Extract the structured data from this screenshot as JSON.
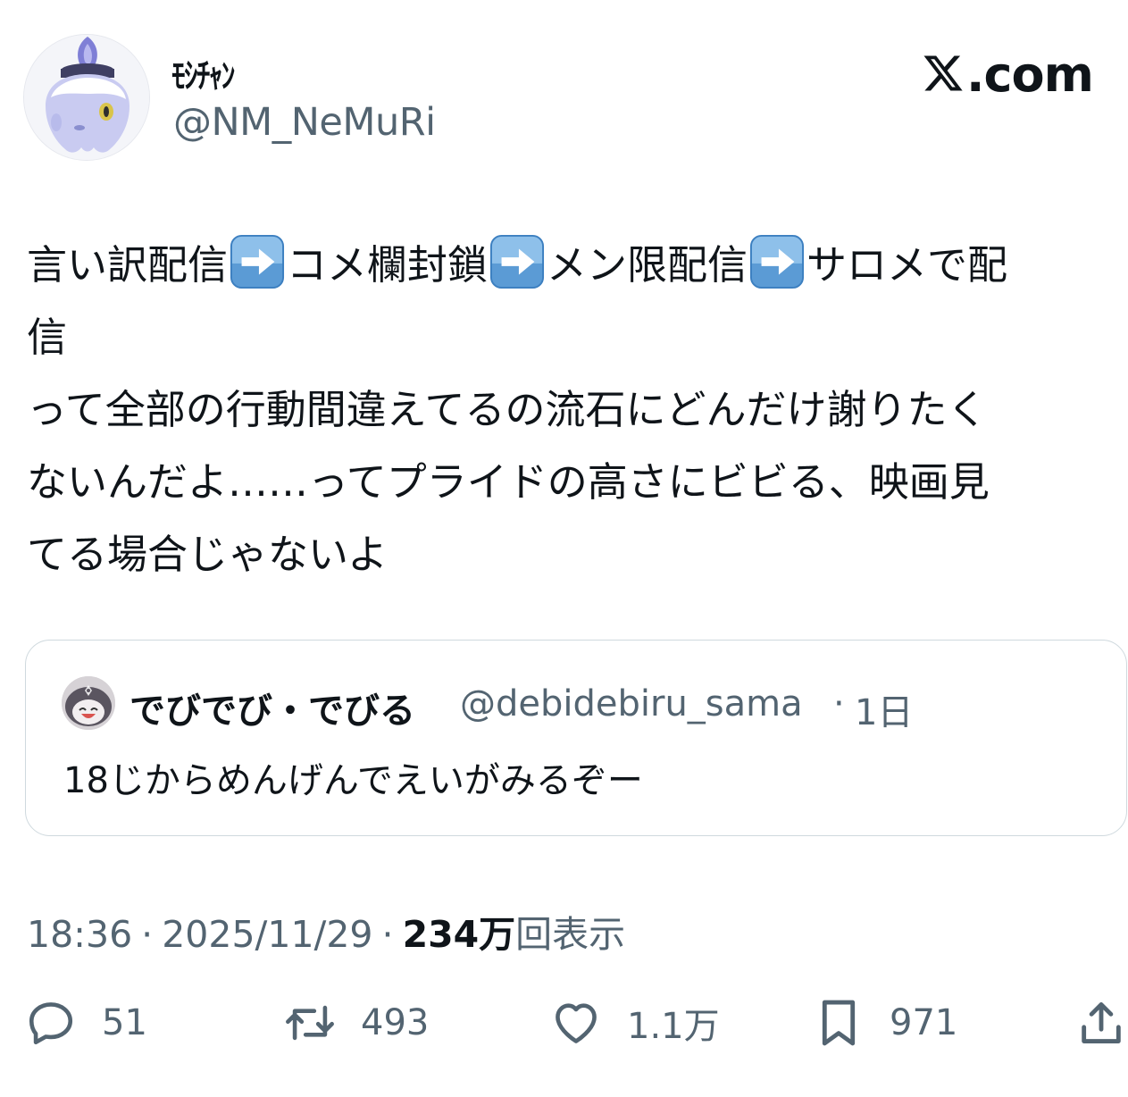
{
  "author": {
    "display_name": "ﾓｼﾁｬﾝ",
    "handle": "@NM_NeMuRi",
    "avatar_icon": "ghost-character-avatar"
  },
  "site_logo": {
    "text": ".com",
    "icon": "x-logo-icon"
  },
  "tweet": {
    "lines": [
      [
        "言い訳配信",
        "arrow",
        "コメ欄封鎖",
        "arrow",
        "メン限配信",
        "arrow",
        "サロメで配"
      ],
      [
        "信"
      ],
      [
        "って全部の行動間違えてるの流石にどんだけ謝りたく"
      ],
      [
        "ないんだよ……ってプライドの高さにビビる、映画見"
      ],
      [
        "てる場合じゃないよ"
      ]
    ],
    "segments": {
      "s1": "言い訳配信",
      "s2": "コメ欄封鎖",
      "s3": "メン限配信",
      "s4": "サロメで配",
      "line2": "信",
      "line3": "って全部の行動間違えてるの流石にどんだけ謝りたく",
      "line4": "ないんだよ……ってプライドの高さにビビる、映画見",
      "line5": "てる場合じゃないよ"
    },
    "emoji": "right-arrow-emoji"
  },
  "quote": {
    "display_name": "でびでび・でびる",
    "handle": "@debidebiru_sama",
    "dot": "·",
    "time": "1日",
    "text": "18じからめんげんでえいがみるぞー",
    "avatar_icon": "character-avatar"
  },
  "meta": {
    "time": "18:36",
    "sep": "·",
    "date": "2025/11/29",
    "views_count": "234万",
    "views_label": "回表示"
  },
  "actions": {
    "replies": "51",
    "reposts": "493",
    "likes": "1.1万",
    "bookmarks": "971"
  },
  "colors": {
    "text": "#0f1419",
    "secondary": "#536471",
    "border": "#cfd9de",
    "emoji_blue": "#4a90d9"
  }
}
